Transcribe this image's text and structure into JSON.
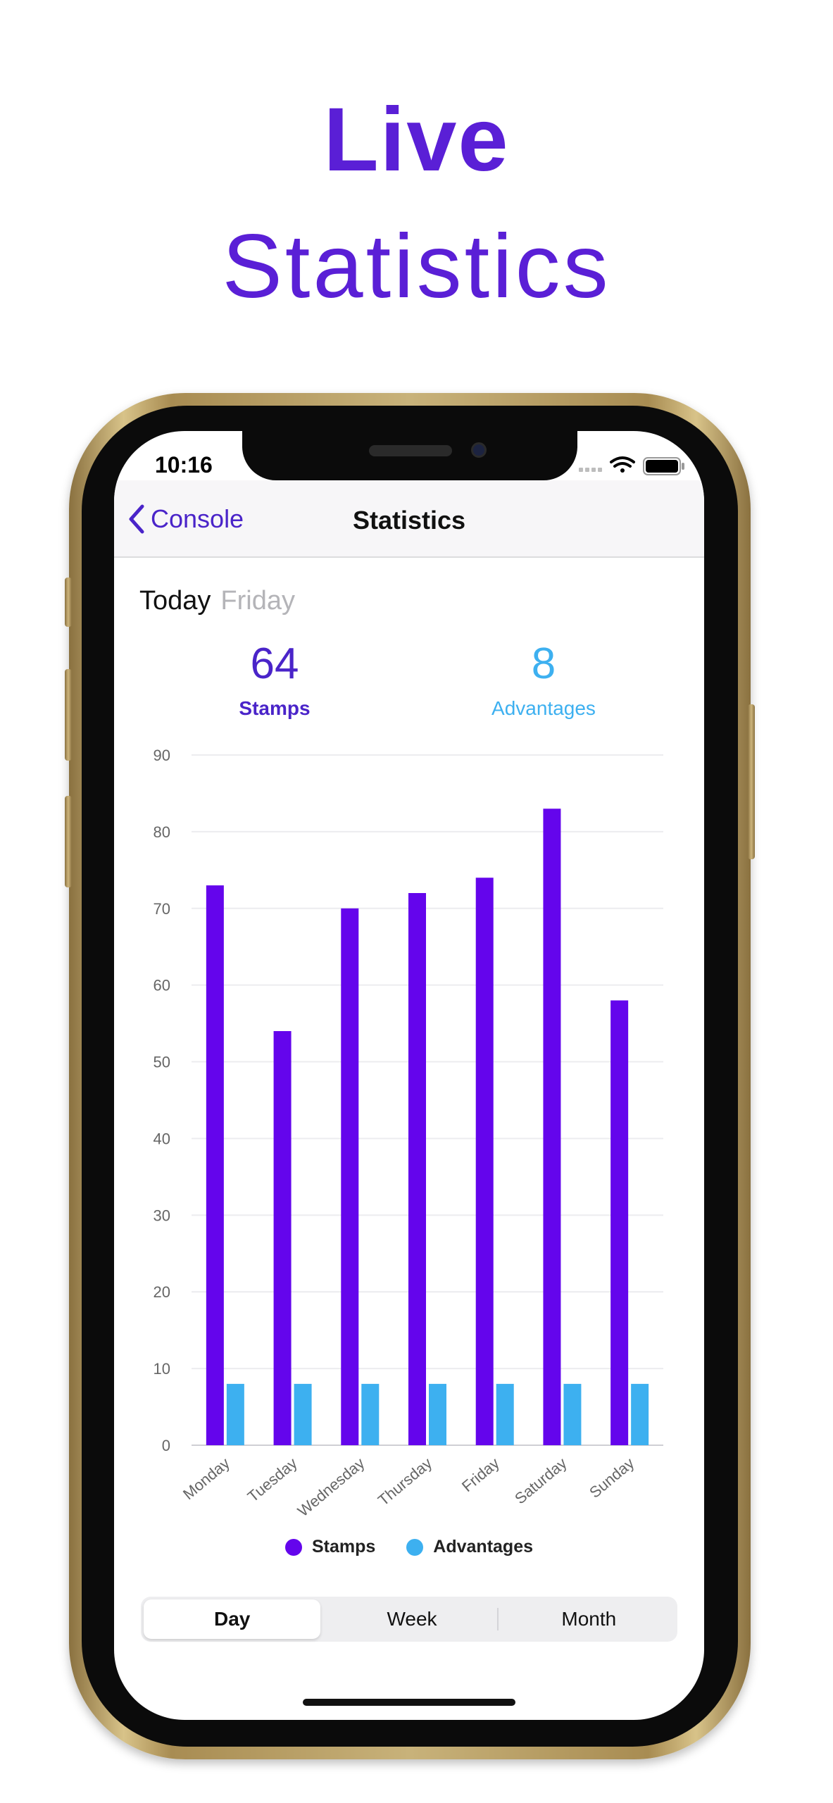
{
  "headline": {
    "line1": "Live",
    "line2": "Statistics"
  },
  "status_bar": {
    "time": "10:16"
  },
  "nav": {
    "back_label": "Console",
    "title": "Statistics"
  },
  "summary": {
    "period": "Today",
    "day": "Friday"
  },
  "stats": {
    "stamps": {
      "value": "64",
      "label": "Stamps"
    },
    "advantages": {
      "value": "8",
      "label": "Advantages"
    }
  },
  "colors": {
    "accent": "#4a24c9",
    "stamps": "#6405ec",
    "advantages": "#3db0f0",
    "headline": "#5a1fd6"
  },
  "chart_data": {
    "type": "bar",
    "categories": [
      "Monday",
      "Tuesday",
      "Wednesday",
      "Thursday",
      "Friday",
      "Saturday",
      "Sunday"
    ],
    "series": [
      {
        "name": "Stamps",
        "values": [
          73,
          54,
          70,
          72,
          74,
          83,
          58
        ]
      },
      {
        "name": "Advantages",
        "values": [
          8,
          8,
          8,
          8,
          8,
          8,
          8
        ]
      }
    ],
    "ylim": [
      0,
      90
    ],
    "yticks": [
      "0",
      "10",
      "20",
      "30",
      "40",
      "50",
      "60",
      "70",
      "80",
      "90"
    ],
    "grid": true,
    "legend": "bottom-center"
  },
  "segments": [
    "Day",
    "Week",
    "Month"
  ]
}
